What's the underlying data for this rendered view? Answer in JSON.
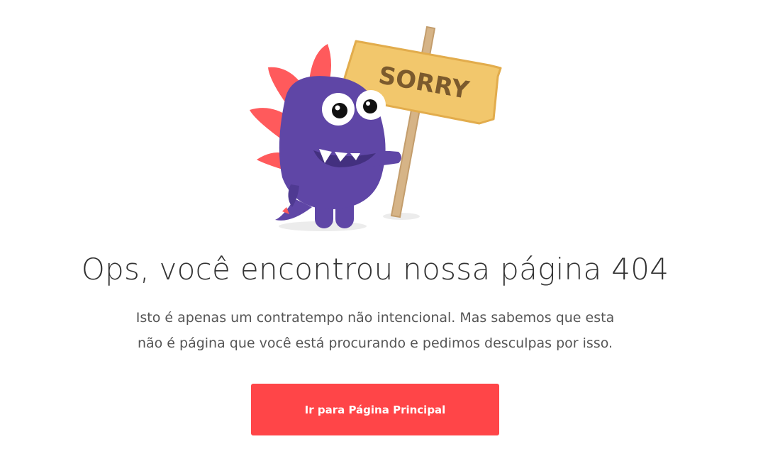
{
  "illustration": {
    "sign_text": "SORRY"
  },
  "main": {
    "heading": "Ops, você encontrou nossa página 404",
    "subtext_line1": "Isto é apenas um contratempo não intencional. Mas sabemos que esta",
    "subtext_line2": "não é página que você está procurando e pedimos desculpas por isso.",
    "button_label": "Ir para Página Principal"
  },
  "colors": {
    "button": "#ff4548",
    "monster": "#5f46a6",
    "spikes": "#ff5a5c",
    "sign": "#f2c76c"
  }
}
